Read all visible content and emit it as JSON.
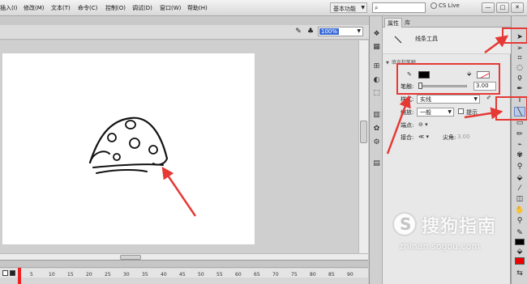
{
  "menubar": {
    "items": [
      "插入(I)",
      "修改(M)",
      "文本(T)",
      "命令(C)",
      "控制(O)",
      "调试(D)",
      "窗口(W)",
      "帮助(H)"
    ],
    "workspace": "基本功能",
    "cs_live": "CS Live",
    "window_buttons": [
      "—",
      "□",
      "✕"
    ]
  },
  "editbar": {
    "zoom": "100%"
  },
  "panel": {
    "tabs": [
      "属性",
      "库"
    ],
    "tool_name": "线条工具",
    "section_title": "填充和笔触",
    "stroke_label": "笔触:",
    "stroke_value": "3.00",
    "style_label": "样式:",
    "style_value": "实线",
    "scale_label": "缩放:",
    "scale_value": "一般",
    "hint_label": "提示",
    "cap_label": "端点:",
    "join_label": "接合:",
    "miter_label": "尖角:",
    "miter_value": "3.00"
  },
  "timeline": {
    "ticks": [
      "5",
      "10",
      "15",
      "20",
      "25",
      "30",
      "35",
      "40",
      "45",
      "50",
      "55",
      "60",
      "65",
      "70",
      "75",
      "80",
      "85",
      "90"
    ]
  },
  "watermark": {
    "title": "搜狗指南",
    "url": "zhinan.sogou.com"
  }
}
